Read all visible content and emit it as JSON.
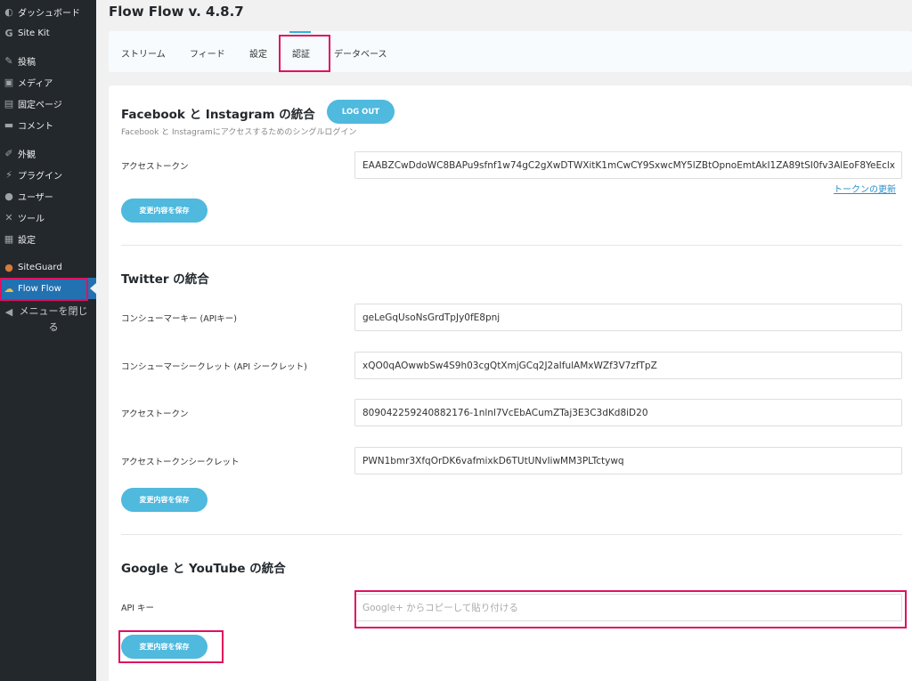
{
  "sidebar": {
    "items": [
      {
        "label": "ダッシュボード",
        "icon": "dashboard-icon"
      },
      {
        "label": "Site Kit",
        "icon": "google-icon"
      },
      {
        "label": "投稿",
        "icon": "pin-icon"
      },
      {
        "label": "メディア",
        "icon": "media-icon"
      },
      {
        "label": "固定ページ",
        "icon": "page-icon"
      },
      {
        "label": "コメント",
        "icon": "comment-icon"
      },
      {
        "label": "外観",
        "icon": "brush-icon"
      },
      {
        "label": "プラグイン",
        "icon": "plugin-icon"
      },
      {
        "label": "ユーザー",
        "icon": "user-icon"
      },
      {
        "label": "ツール",
        "icon": "wrench-icon"
      },
      {
        "label": "設定",
        "icon": "settings-icon"
      },
      {
        "label": "SiteGuard",
        "icon": "siteguard-icon"
      },
      {
        "label": "Flow Flow",
        "icon": "flowflow-icon"
      }
    ],
    "collapse_label": "メニューを閉じる"
  },
  "header": {
    "title": "Flow Flow v. 4.8.7"
  },
  "tabs": [
    {
      "label": "ストリーム"
    },
    {
      "label": "フィード"
    },
    {
      "label": "設定"
    },
    {
      "label": "認証"
    },
    {
      "label": "データベース"
    }
  ],
  "facebook": {
    "title": "Facebook と Instagram の統合",
    "logout": "LOG OUT",
    "desc": "Facebook と Instagramにアクセスするためのシングルログイン",
    "token_label": "アクセストークン",
    "token_value": "EAABZCwDdoWC8BAPu9sfnf1w74gC2gXwDTWXitK1mCwCY9SxwcMY5lZBtOpnoEmtAkI1ZA89tSI0fv3AlEoF8YeEclx",
    "refresh_link": "トークンの更新",
    "save": "変更内容を保存"
  },
  "twitter": {
    "title": "Twitter の統合",
    "fields": [
      {
        "label": "コンシューマーキー (APIキー)",
        "value": "geLeGqUsoNsGrdTpJy0fE8pnj"
      },
      {
        "label": "コンシューマーシークレット (API シークレット)",
        "value": "xQO0qAOwwbSw4S9h03cgQtXmjGCq2J2aIfulAMxWZf3V7zfTpZ"
      },
      {
        "label": "アクセストークン",
        "value": "809042259240882176-1nlnl7VcEbACumZTaj3E3C3dKd8iD20"
      },
      {
        "label": "アクセストークンシークレット",
        "value": "PWN1bmr3XfqOrDK6vafmixkD6TUtUNvIiwMM3PLTctywq"
      }
    ],
    "save": "変更内容を保存"
  },
  "google": {
    "title": "Google と YouTube の統合",
    "api_label": "API キー",
    "api_placeholder": "Google+ からコピーして貼り付ける",
    "save": "変更内容を保存"
  },
  "colors": {
    "accent": "#4fb9de",
    "highlight": "#e0115f",
    "sidebar": "#23282d",
    "active": "#2271b1"
  }
}
